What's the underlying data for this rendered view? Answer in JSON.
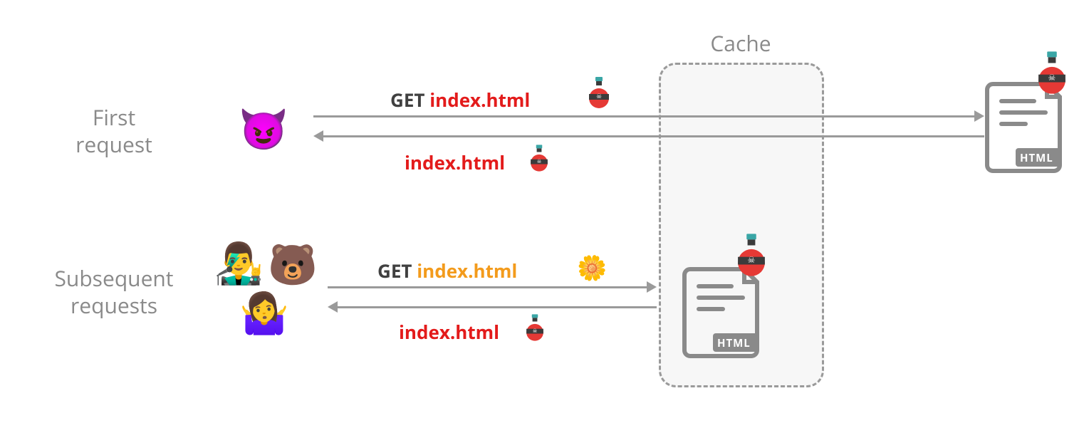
{
  "labels": {
    "cache": "Cache",
    "first_request_line1": "First",
    "first_request_line2": "request",
    "subsequent_line1": "Subsequent",
    "subsequent_line2": "requests"
  },
  "first": {
    "request_method": "GET",
    "request_file": "index.html",
    "response_file": "index.html"
  },
  "subsequent": {
    "request_method": "GET",
    "request_file": "index.html",
    "response_file": "index.html"
  },
  "icons": {
    "devil": "😈",
    "singer": "👨‍🎤",
    "bear": "🐻",
    "shrug": "🤷‍♀️",
    "flower": "🌼",
    "file_badge": "HTML"
  },
  "colors": {
    "gray": "#8a8a8a",
    "red": "#e31b1b",
    "orange": "#f39b1c",
    "flask_body": "#e53935",
    "flask_band": "#3b3b3b",
    "flask_cap": "#3aa6a6"
  }
}
